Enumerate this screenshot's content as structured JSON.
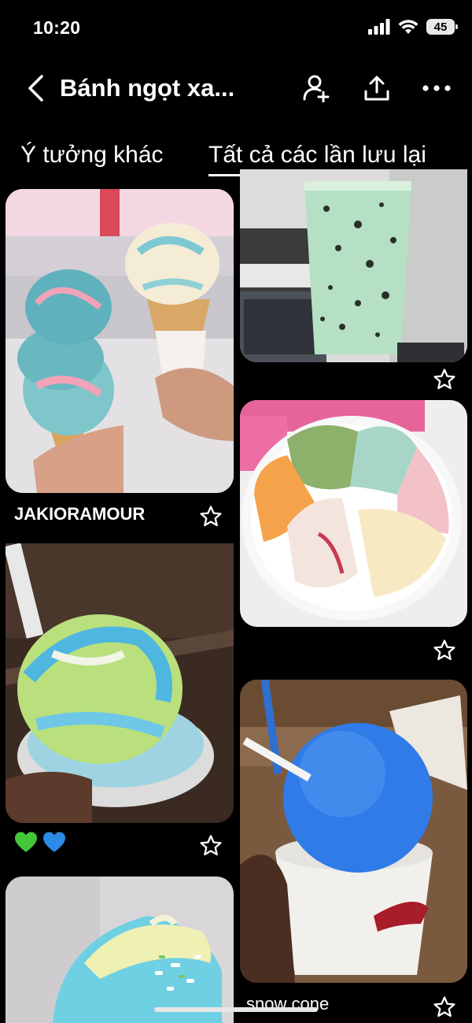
{
  "status_bar": {
    "time": "10:20",
    "battery": "45"
  },
  "header": {
    "title": "Bánh ngọt xa..."
  },
  "tabs": [
    {
      "label": "Ý tưởng khác",
      "active": false
    },
    {
      "label": "Tất cả các lần lưu lại",
      "active": true
    }
  ],
  "pins": {
    "pin1": {
      "caption": "JAKIORAMOUR",
      "description": "two ice cream cones"
    },
    "pin2": {
      "caption": "",
      "description": "mint cookies and cream drink"
    },
    "pin3": {
      "caption": "",
      "description": "bowl of assorted ice cream"
    },
    "pin4": {
      "caption": "",
      "description": "blue and green ice cream cup",
      "emojis": "💚💙"
    },
    "pin5": {
      "caption": "snow cone",
      "description": "blue snow cone"
    },
    "pin6": {
      "caption": "",
      "description": "blue ice cream close up"
    }
  },
  "colors": {
    "background": "#000000",
    "text": "#ffffff"
  },
  "icons": [
    "chevron-left-icon",
    "add-collaborator-icon",
    "share-icon",
    "more-icon",
    "star-icon",
    "signal-icon",
    "wifi-icon",
    "battery-icon"
  ]
}
